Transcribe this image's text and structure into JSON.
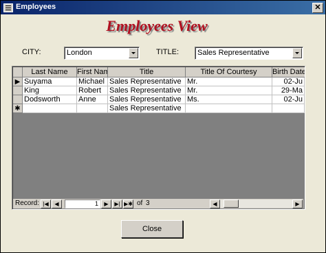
{
  "window": {
    "title": "Employees",
    "close_glyph": "✕"
  },
  "form_title": "Employees View",
  "filters": {
    "city_label": "CITY:",
    "city_value": "London",
    "title_label": "TITLE:",
    "title_value": "Sales Representative"
  },
  "grid": {
    "columns": [
      "Last Name",
      "First Name",
      "Title",
      "Title Of Courtesy",
      "Birth Date"
    ],
    "rows": [
      [
        "Suyama",
        "Michael",
        "Sales Representative",
        "Mr.",
        "02-Ju"
      ],
      [
        "King",
        "Robert",
        "Sales Representative",
        "Mr.",
        "29-Ma"
      ],
      [
        "Dodsworth",
        "Anne",
        "Sales Representative",
        "Ms.",
        "02-Ju"
      ]
    ],
    "new_row": [
      "",
      "",
      "Sales Representative",
      "",
      ""
    ],
    "current_marker": "▶",
    "new_marker": "✱"
  },
  "navigation": {
    "record_label": "Record:",
    "current_record": "1",
    "of_label": "of",
    "total_records": "3",
    "first_glyph": "|◀",
    "prev_glyph": "◀",
    "next_glyph": "▶",
    "last_glyph": "▶|",
    "new_glyph": "▶✱",
    "scroll_left_glyph": "◀",
    "scroll_right_glyph": "▶"
  },
  "close_button": {
    "label": "Close"
  }
}
